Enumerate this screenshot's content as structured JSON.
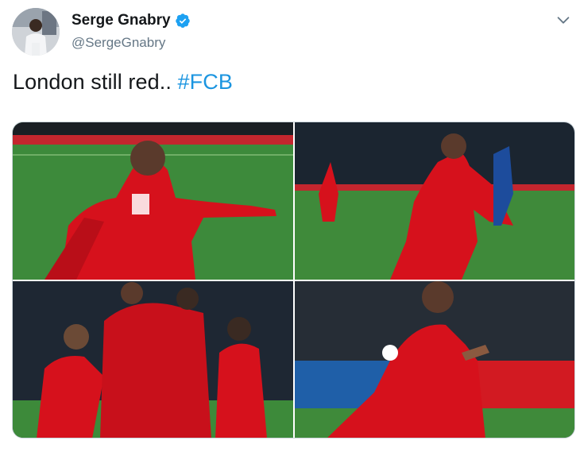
{
  "author": {
    "display_name": "Serge Gnabry",
    "handle": "@SergeGnabry",
    "verified": true
  },
  "tweet": {
    "text": "London still red.. ",
    "hashtag": "#FCB"
  },
  "media": [
    {
      "name": "photo-1"
    },
    {
      "name": "photo-2"
    },
    {
      "name": "photo-3"
    },
    {
      "name": "photo-4"
    }
  ],
  "colors": {
    "link": "#1b95e0",
    "verified": "#1da1f2",
    "kit_red": "#d6111c",
    "pitch_green": "#3f8a3a"
  },
  "icons": [
    "verified-badge-icon",
    "chevron-down-icon"
  ]
}
